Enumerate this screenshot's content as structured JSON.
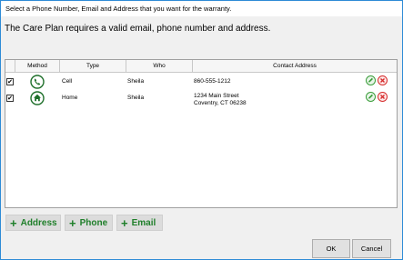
{
  "header": {
    "instruction": "Select a Phone Number, Email and Address that you want for the warranty."
  },
  "message": "The Care Plan requires a valid email, phone number and address.",
  "table": {
    "columns": [
      "Method",
      "Type",
      "Who",
      "Contact Address"
    ],
    "rows": [
      {
        "checked": "✔",
        "method_icon": "phone-icon",
        "type": "Cell",
        "who": "Sheila",
        "address_line1": "860-555-1212",
        "address_line2": ""
      },
      {
        "checked": "✔",
        "method_icon": "home-icon",
        "type": "Home",
        "who": "Sheila",
        "address_line1": "1234 Main Street",
        "address_line2": "Coventry, CT 06238"
      }
    ]
  },
  "add_buttons": {
    "address": "Address",
    "phone": "Phone",
    "email": "Email",
    "plus": "+"
  },
  "footer": {
    "ok": "OK",
    "cancel": "Cancel"
  },
  "colors": {
    "accent": "#2e8bd6",
    "add_green": "#1f7f2a",
    "edit_green": "#3a9d3a",
    "delete_red": "#d62b2b"
  }
}
